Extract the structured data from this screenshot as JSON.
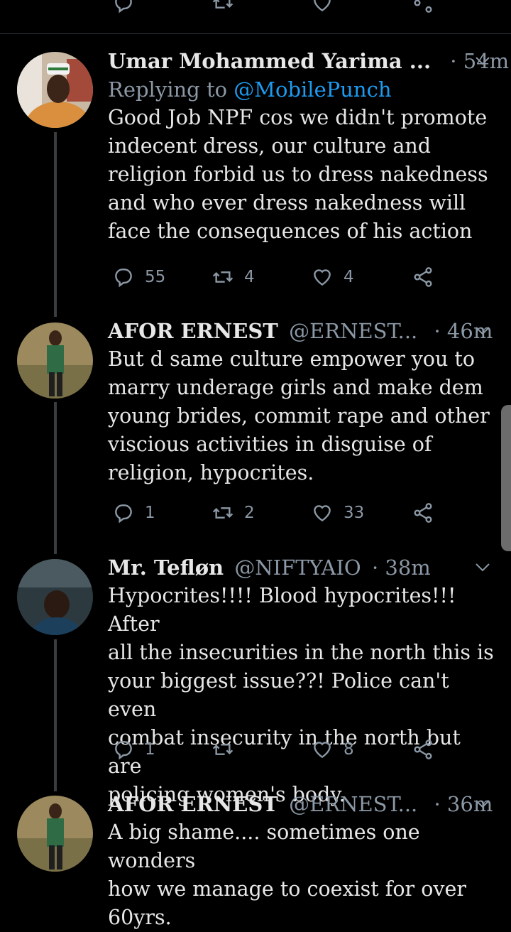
{
  "tweets": [
    {
      "name": "Umar Mohammed Yarima ...",
      "handle": "",
      "time": "· 54m",
      "replying_prefix": "Replying to ",
      "replying_to": "@MobilePunch",
      "text": "Good Job NPF cos we didn't promote indecent dress, our culture and religion forbid us to dress nakedness and who ever dress nakedness will face the consequences of his action",
      "lines": [
        "Good Job NPF cos we didn't promote",
        "indecent dress, our culture and",
        "religion forbid us to dress nakedness",
        "and who ever dress nakedness will",
        "face the consequences of his action"
      ],
      "replies": "55",
      "retweets": "4",
      "likes": "4"
    },
    {
      "name": "AFOR ERNEST",
      "handle": "@ERNEST...",
      "time": "· 46m",
      "lines": [
        "But d same culture empower you to",
        "marry underage girls and make dem",
        "young brides, commit rape and other",
        "viscious activities in disguise of",
        "religion, hypocrites."
      ],
      "replies": "1",
      "retweets": "2",
      "likes": "33"
    },
    {
      "name": "Mr. Tefløn",
      "handle": "@NIFTYAIO",
      "time": "· 38m",
      "lines": [
        "Hypocrites!!!! Blood hypocrites!!! After",
        "all the insecurities in the north this is",
        "your biggest issue??! Police can't even",
        "combat insecurity in the north but are",
        "policing women's body."
      ],
      "replies": "1",
      "retweets": "",
      "likes": "8"
    },
    {
      "name": "AFOR ERNEST",
      "handle": "@ERNEST...",
      "time": "· 36m",
      "lines": [
        "A big shame.... sometimes one wonders",
        "how we manage to coexist for over",
        "60yrs."
      ]
    }
  ],
  "icons": {
    "reply": "reply-icon",
    "retweet": "retweet-icon",
    "like": "heart-icon",
    "share": "share-icon",
    "more": "chevron-down-icon"
  }
}
